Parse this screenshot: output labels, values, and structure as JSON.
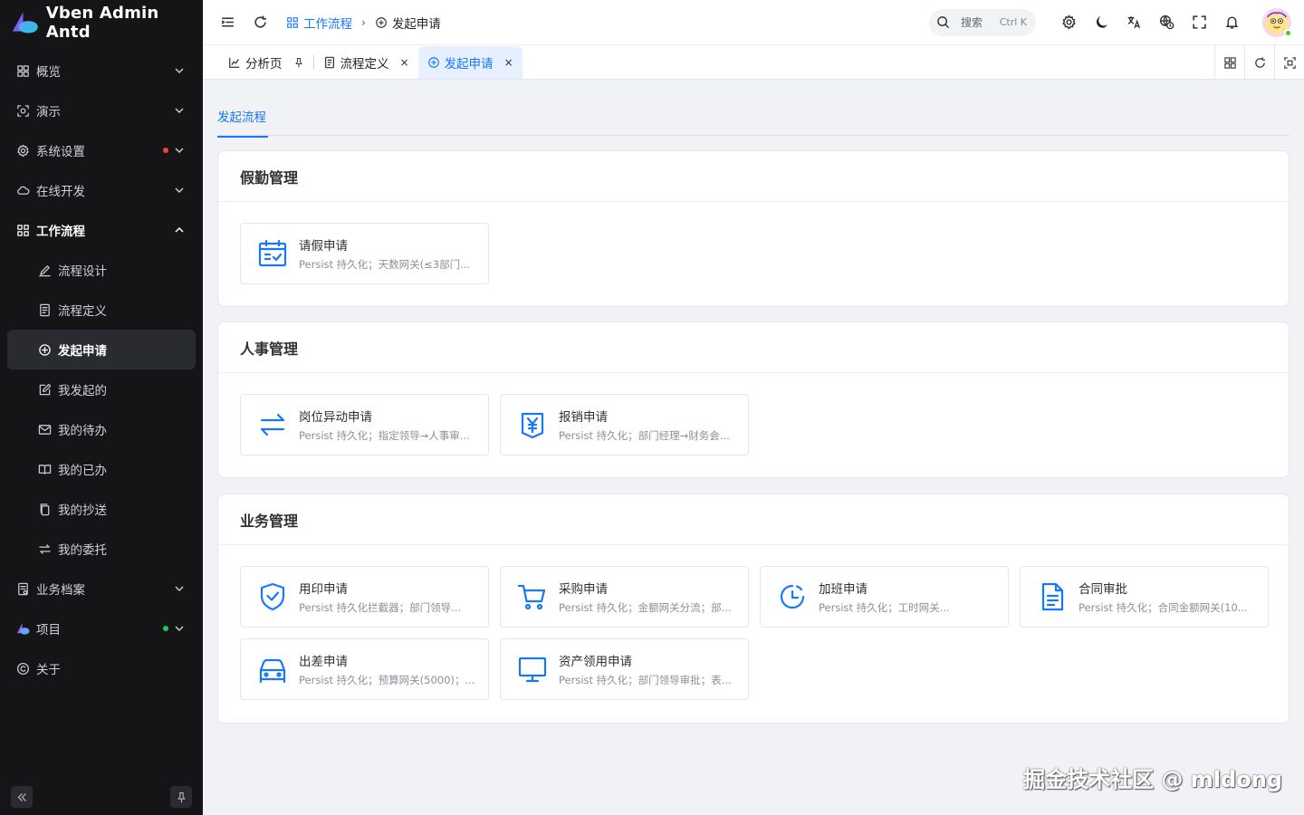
{
  "brand": {
    "title": "Vben Admin Antd"
  },
  "sidebar": {
    "items": [
      {
        "label": "概览",
        "icon": "dashboard-icon",
        "arrow": "down"
      },
      {
        "label": "演示",
        "icon": "demo-icon",
        "arrow": "down"
      },
      {
        "label": "系统设置",
        "icon": "gear-icon",
        "arrow": "down",
        "dot": "#ef4444"
      },
      {
        "label": "在线开发",
        "icon": "cloud-icon",
        "arrow": "down"
      },
      {
        "label": "工作流程",
        "icon": "workflow-icon",
        "arrow": "up",
        "open": true
      },
      {
        "label": "流程设计",
        "icon": "design-icon",
        "sub": true
      },
      {
        "label": "流程定义",
        "icon": "definition-icon",
        "sub": true
      },
      {
        "label": "发起申请",
        "icon": "plus-circle-icon",
        "sub": true,
        "active": true
      },
      {
        "label": "我发起的",
        "icon": "edit-icon",
        "sub": true
      },
      {
        "label": "我的待办",
        "icon": "mail-icon",
        "sub": true
      },
      {
        "label": "我的已办",
        "icon": "book-icon",
        "sub": true
      },
      {
        "label": "我的抄送",
        "icon": "copy-icon",
        "sub": true
      },
      {
        "label": "我的委托",
        "icon": "transfer-icon",
        "sub": true
      },
      {
        "label": "业务档案",
        "icon": "archive-icon",
        "arrow": "down"
      },
      {
        "label": "项目",
        "icon": "project-logo-icon",
        "arrow": "down",
        "dot": "#22c55e"
      },
      {
        "label": "关于",
        "icon": "copyright-icon"
      }
    ]
  },
  "header": {
    "breadcrumb": [
      {
        "label": "工作流程",
        "icon": "workflow-icon",
        "link": true
      },
      {
        "label": "发起申请",
        "icon": "plus-circle-icon",
        "link": false
      }
    ],
    "breadcrumb_sep": "›",
    "search_placeholder": "搜索",
    "search_shortcut": "Ctrl K"
  },
  "tabs": [
    {
      "label": "分析页",
      "icon": "chart-icon",
      "pinned": true
    },
    {
      "label": "流程定义",
      "icon": "definition-icon",
      "closable": true
    },
    {
      "label": "发起申请",
      "icon": "plus-circle-icon",
      "closable": true,
      "active": true
    }
  ],
  "tab_close": "×",
  "subtab": {
    "label": "发起流程"
  },
  "groups": [
    {
      "title": "假勤管理",
      "flows": [
        {
          "name": "请假申请",
          "desc": "Persist 持久化；天数网关(≤3部门...",
          "icon": "calendar-check-icon"
        }
      ]
    },
    {
      "title": "人事管理",
      "flows": [
        {
          "name": "岗位异动申请",
          "desc": "Persist 持久化；指定领导→人事审...",
          "icon": "swap-icon"
        },
        {
          "name": "报销申请",
          "desc": "Persist 持久化；部门经理→财务会...",
          "icon": "yen-icon"
        }
      ]
    },
    {
      "title": "业务管理",
      "flows": [
        {
          "name": "用印申请",
          "desc": "Persist 持久化拦截器；部门领导...",
          "icon": "shield-check-icon"
        },
        {
          "name": "采购申请",
          "desc": "Persist 持久化；金额网关分流；部...",
          "icon": "cart-icon"
        },
        {
          "name": "加班申请",
          "desc": "Persist 持久化；工时网关...",
          "icon": "clock-icon"
        },
        {
          "name": "合同审批",
          "desc": "Persist 持久化；合同金额网关(10...",
          "icon": "file-text-icon"
        },
        {
          "name": "出差申请",
          "desc": "Persist 持久化；预算网关(5000)；...",
          "icon": "car-icon"
        },
        {
          "name": "资产领用申请",
          "desc": "Persist 持久化；部门领导审批；表...",
          "icon": "monitor-icon"
        }
      ]
    }
  ],
  "watermark": "掘金技术社区 @ mldong",
  "colors": {
    "accent": "#1677ff",
    "sidebar_bg": "#151518",
    "dot_red": "#ef4444",
    "dot_green": "#22c55e"
  }
}
